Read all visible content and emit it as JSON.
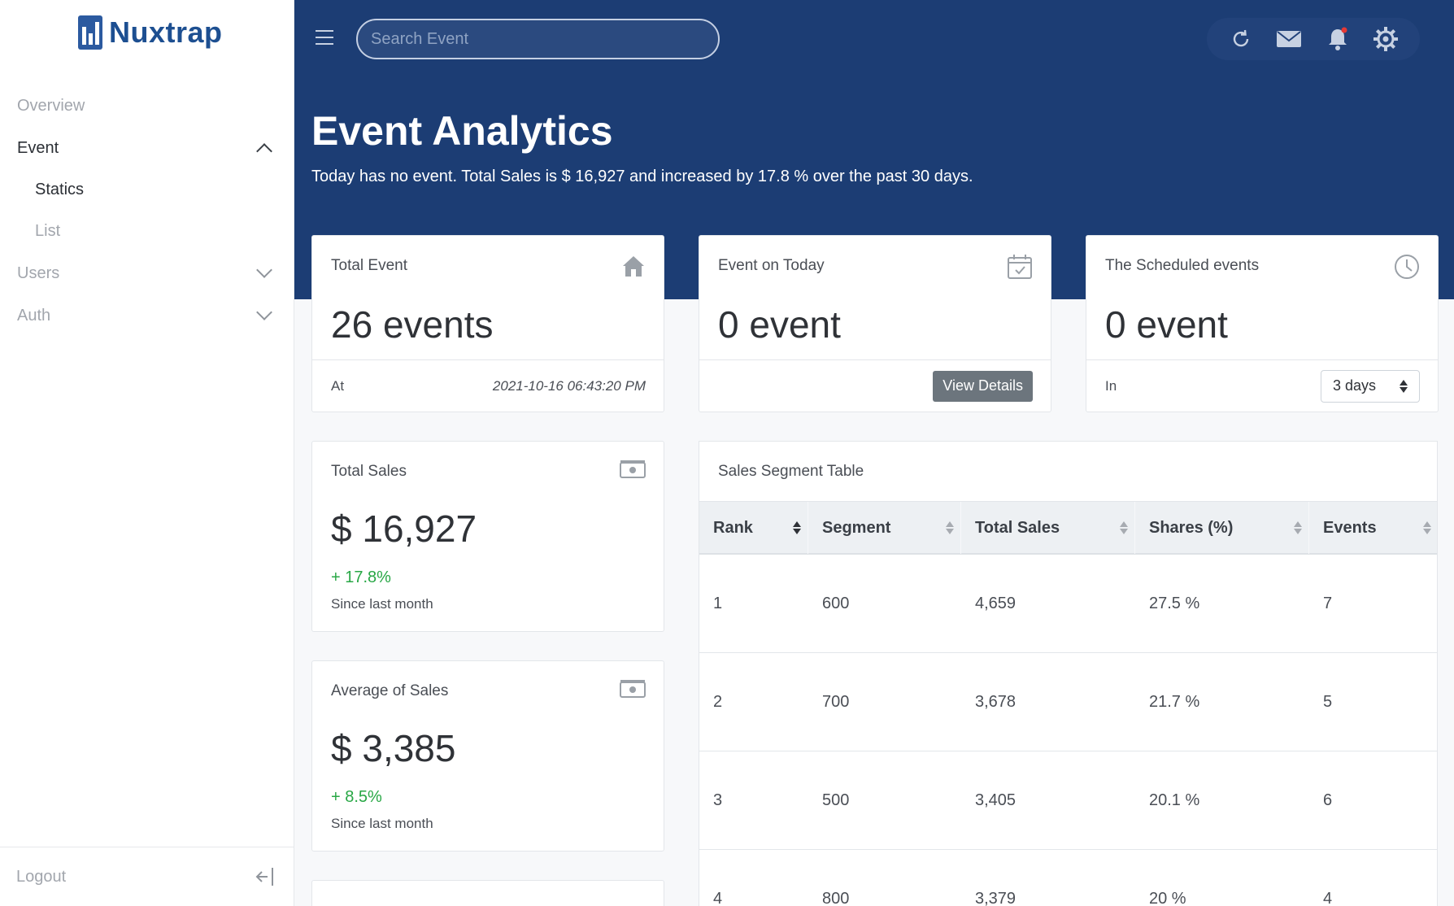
{
  "app": {
    "name": "Nuxtrap"
  },
  "sidebar": {
    "items": [
      {
        "label": "Overview"
      },
      {
        "label": "Event",
        "children": [
          {
            "label": "Statics"
          },
          {
            "label": "List"
          }
        ]
      },
      {
        "label": "Users"
      },
      {
        "label": "Auth"
      }
    ],
    "logout_label": "Logout"
  },
  "header": {
    "search": {
      "placeholder": "Search Event"
    },
    "toolbar_icons": [
      "refresh-icon",
      "mail-icon",
      "bell-icon",
      "gear-icon"
    ],
    "notification_dot_color": "#e53935"
  },
  "page": {
    "title": "Event Analytics",
    "subtitle": "Today has no event. Total Sales is $ 16,927 and increased by 17.8 % over the past 30 days."
  },
  "cards": {
    "total_event": {
      "label": "Total Event",
      "value": "26 events",
      "foot_label": "At",
      "timestamp": "2021-10-16 06:43:20 PM",
      "icon": "home-icon"
    },
    "event_today": {
      "label": "Event on Today",
      "value": "0 event",
      "button": "View Details",
      "icon": "calendar-check-icon"
    },
    "scheduled": {
      "label": "The Scheduled events",
      "value": "0 event",
      "foot_label": "In",
      "select_value": "3 days",
      "icon": "clock-icon"
    },
    "total_sales": {
      "label": "Total Sales",
      "value": "$ 16,927",
      "delta": "+ 17.8%",
      "since": "Since last month",
      "icon": "money-icon"
    },
    "avg_sales": {
      "label": "Average of Sales",
      "value": "$ 3,385",
      "delta": "+ 8.5%",
      "since": "Since last month",
      "icon": "money-icon"
    }
  },
  "sales_table": {
    "title": "Sales Segment Table",
    "columns": [
      "Rank",
      "Segment",
      "Total Sales",
      "Shares (%)",
      "Events"
    ],
    "rows": [
      [
        "1",
        "600",
        "4,659",
        "27.5 %",
        "7"
      ],
      [
        "2",
        "700",
        "3,678",
        "21.7 %",
        "5"
      ],
      [
        "3",
        "500",
        "3,405",
        "20.1 %",
        "6"
      ],
      [
        "4",
        "800",
        "3,379",
        "20 %",
        "4"
      ]
    ]
  },
  "colors": {
    "header_bg": "#1c3d74",
    "accent": "#1d4f91",
    "positive": "#28a745"
  }
}
